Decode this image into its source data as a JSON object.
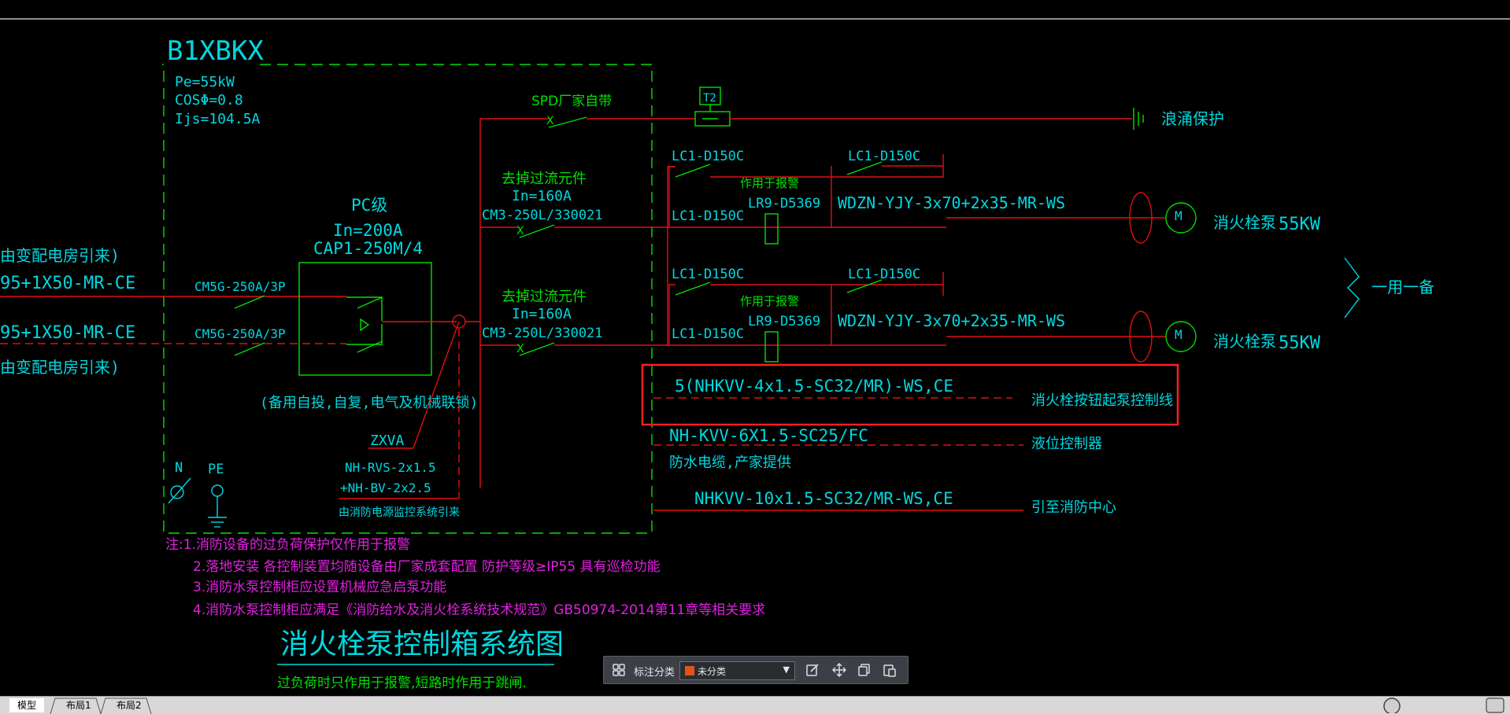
{
  "drawing": {
    "panel_name": "B1XBKX",
    "panel_params": [
      "Pe=55kW",
      "COSΦ=0.8",
      "Ijs=104.5A"
    ],
    "incoming_top_note": "由变配电房引来)",
    "incoming_cable_1": "95+1X50-MR-CE",
    "incoming_cable_2": "95+1X50-MR-CE",
    "incoming_bottom_note": "由变配电房引来)",
    "breaker_1": "CM5G-250A/3P",
    "breaker_2": "CM5G-250A/3P",
    "ats_title": "PC级",
    "ats_rating": "In=200A",
    "ats_model": "CAP1-250M/4",
    "ats_note": "(备用自投,自复,电气及机械联锁)",
    "zxva_label": "ZXVA",
    "rvs_label_1": "NH-RVS-2x1.5",
    "rvs_label_2": "+NH-BV-2x2.5",
    "rvs_note": "由消防电源监控系统引来",
    "n_label": "N",
    "pe_label": "PE",
    "spd_label": "SPD厂家自带",
    "spd_box": "T2",
    "surge_label": "浪涌保护",
    "branch_1": {
      "note": "去掉过流元件",
      "rating": "In=160A",
      "breaker": "CM3-250L/330021",
      "contactor_a": "LC1-D150C",
      "contactor_b": "LC1-D150C",
      "contactor_c": "LC1-D150C",
      "relay_note": "作用于报警",
      "relay": "LR9-D5369",
      "cable": "WDZN-YJY-3x70+2x35-MR-WS",
      "load": "消火栓泵",
      "power": "55KW"
    },
    "branch_2": {
      "note": "去掉过流元件",
      "rating": "In=160A",
      "breaker": "CM3-250L/330021",
      "contactor_a": "LC1-D150C",
      "contactor_b": "LC1-D150C",
      "contactor_c": "LC1-D150C",
      "relay_note": "作用于报警",
      "relay": "LR9-D5369",
      "cable": "WDZN-YJY-3x70+2x35-MR-WS",
      "load": "消火栓泵",
      "power": "55KW"
    },
    "duty_note": "一用一备",
    "motor_symbol": "M",
    "control_line_1": "5(NHKVV-4x1.5-SC32/MR)-WS,CE",
    "control_line_1_desc": "消火栓按钮起泵控制线",
    "control_line_2": "NH-KVV-6X1.5-SC25/FC",
    "control_line_2_sub": "防水电缆,产家提供",
    "control_line_2_desc": "液位控制器",
    "control_line_3": "NHKVV-10x1.5-SC32/MR-WS,CE",
    "control_line_3_desc": "引至消防中心",
    "notes": [
      "注:1.消防设备的过负荷保护仅作用于报警",
      "2.落地安装  各控制装置均随设备由厂家成套配置 防护等级≥IP55 具有巡检功能",
      "3.消防水泵控制柜应设置机械应急启泵功能",
      "4.消防水泵控制柜应满足《消防给水及消火栓系统技术规范》GB50974-2014第11章等相关要求"
    ],
    "title": "消火栓泵控制箱系统图",
    "subtitle": "过负荷时只作用于报警,短路时作用于跳闸."
  },
  "toolbar": {
    "label": "标注分类",
    "selected": "未分类",
    "swatch_color": "#e8501a"
  },
  "tabs": [
    "模型",
    "布局1",
    "布局2"
  ],
  "colors": {
    "cyan": "#00d8e0",
    "green": "#00e000",
    "red": "#e01010",
    "magenta": "#e020e0",
    "highlight": "#ff2020"
  }
}
